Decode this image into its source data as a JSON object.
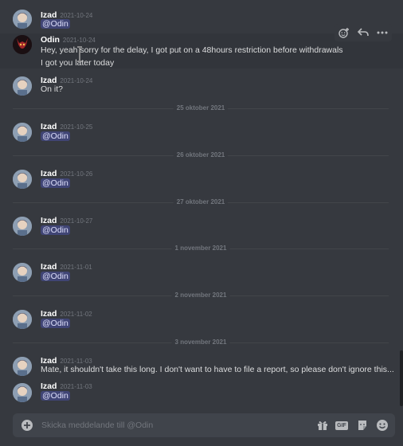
{
  "messages": {
    "groups": [
      {
        "author": "Izad",
        "timestamp": "2021-10-24",
        "lines": [
          {
            "mention": "@Odin"
          }
        ]
      },
      {
        "author": "Odin",
        "timestamp": "2021-10-24",
        "lines": [
          {
            "text": "Hey, yeah sorry for the delay, I got put on a 48hours restriction before withdrawals"
          },
          {
            "text": "I got you later today"
          }
        ]
      },
      {
        "author": "Izad",
        "timestamp": "2021-10-24",
        "lines": [
          {
            "text": "On it?"
          }
        ]
      },
      {
        "author": "Izad",
        "timestamp": "2021-10-25",
        "lines": [
          {
            "mention": "@Odin"
          }
        ]
      },
      {
        "author": "Izad",
        "timestamp": "2021-10-26",
        "lines": [
          {
            "mention": "@Odin"
          }
        ]
      },
      {
        "author": "Izad",
        "timestamp": "2021-10-27",
        "lines": [
          {
            "mention": "@Odin"
          }
        ]
      },
      {
        "author": "Izad",
        "timestamp": "2021-11-01",
        "lines": [
          {
            "mention": "@Odin"
          }
        ]
      },
      {
        "author": "Izad",
        "timestamp": "2021-11-02",
        "lines": [
          {
            "mention": "@Odin"
          }
        ]
      },
      {
        "author": "Izad",
        "timestamp": "2021-11-03",
        "lines": [
          {
            "text": "Mate, it shouldn't take this long. I don't want to have to file a report, so please don't ignore this..."
          }
        ]
      },
      {
        "author": "Izad",
        "timestamp": "2021-11-03",
        "lines": [
          {
            "mention": "@Odin"
          }
        ]
      }
    ],
    "dividers": [
      "25 oktober 2021",
      "26 oktober 2021",
      "27 oktober 2021",
      "1 november 2021",
      "2 november 2021",
      "3 november 2021"
    ]
  },
  "hover_toolbar": {
    "icons": [
      "add-reaction-icon",
      "reply-icon",
      "more-icon"
    ]
  },
  "composer": {
    "placeholder": "Skicka meddelande till @Odin",
    "value": "",
    "buttons": [
      "gift-icon",
      "gif-icon",
      "sticker-icon",
      "emoji-icon"
    ],
    "gif_label": "GIF"
  },
  "colors": {
    "background": "#36393f",
    "composer": "#40444b",
    "mention_text": "#dee0fc",
    "mention_bg": "#5865f2",
    "username": "#ffffff",
    "timestamp": "#72767d",
    "message": "#dcddde"
  }
}
